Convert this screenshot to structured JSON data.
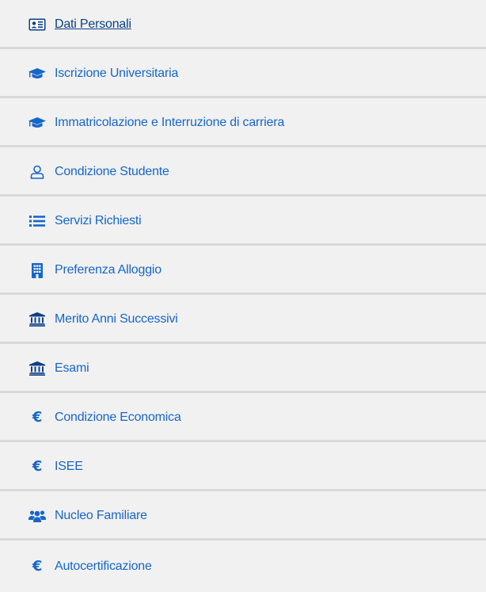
{
  "menu": {
    "items": [
      {
        "label": "Dati Personali",
        "icon": "id-card-icon"
      },
      {
        "label": "Iscrizione Universitaria",
        "icon": "graduation-cap-icon"
      },
      {
        "label": "Immatricolazione e Interruzione di carriera",
        "icon": "graduation-cap-icon"
      },
      {
        "label": "Condizione Studente",
        "icon": "user-icon"
      },
      {
        "label": "Servizi Richiesti",
        "icon": "list-icon"
      },
      {
        "label": "Preferenza Alloggio",
        "icon": "building-icon"
      },
      {
        "label": "Merito Anni Successivi",
        "icon": "university-icon"
      },
      {
        "label": "Esami",
        "icon": "university-icon"
      },
      {
        "label": "Condizione Economica",
        "icon": "euro-icon"
      },
      {
        "label": "ISEE",
        "icon": "euro-icon"
      },
      {
        "label": "Nucleo Familiare",
        "icon": "users-icon"
      },
      {
        "label": "Autocertificazione",
        "icon": "euro-icon"
      }
    ],
    "euro_symbol": "€"
  },
  "colors": {
    "link": "#1666c9",
    "active_link": "#0b3f86",
    "background": "#f1f1f1",
    "divider": "#d9d9d9"
  }
}
